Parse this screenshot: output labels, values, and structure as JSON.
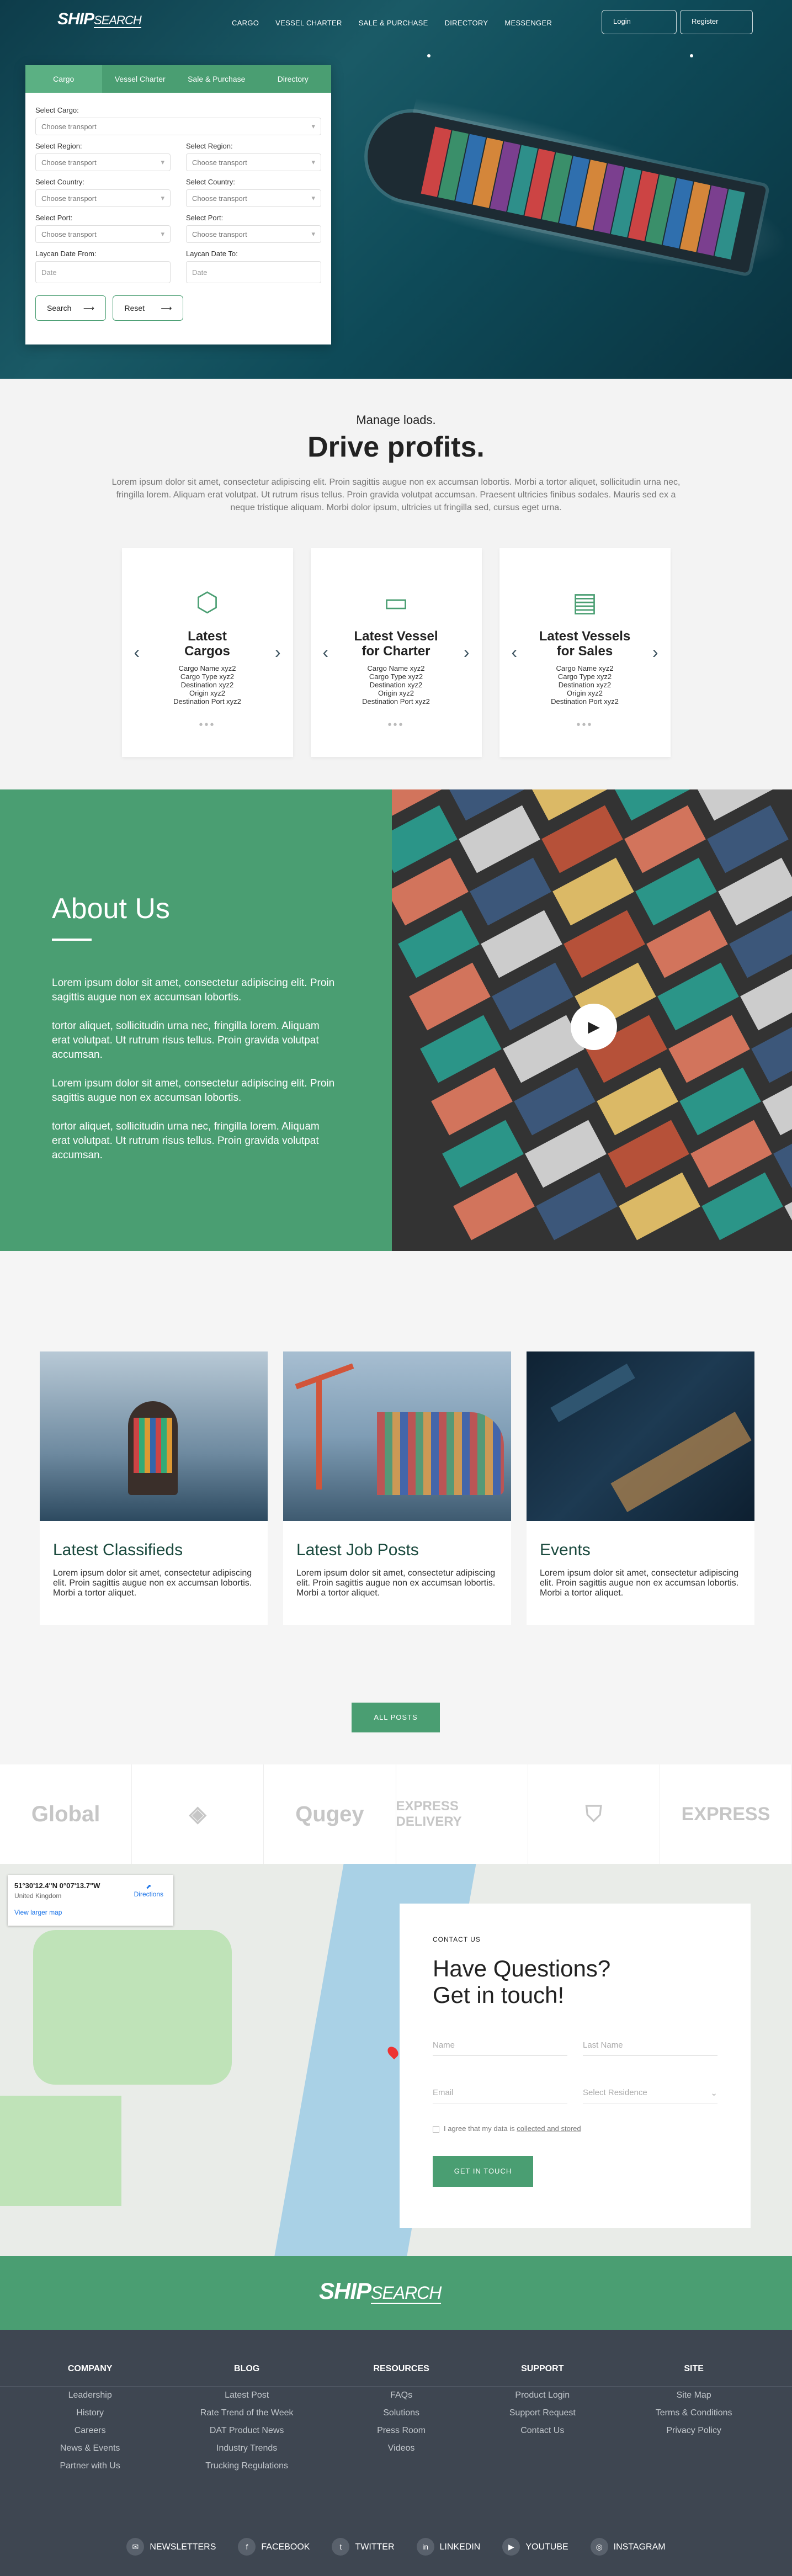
{
  "brand": {
    "logo_main": "SHIP",
    "logo_sub": "SEARCH"
  },
  "nav": {
    "links": [
      "CARGO",
      "VESSEL CHARTER",
      "SALE & PURCHASE",
      "DIRECTORY",
      "MESSENGER"
    ],
    "login": "Login",
    "register": "Register"
  },
  "search": {
    "tabs": [
      "Cargo",
      "Vessel Charter",
      "Sale & Purchase",
      "Directory"
    ],
    "cargo_label": "Select Cargo:",
    "cargo_ph": "Choose transport",
    "region_label": "Select Region:",
    "region_ph": "Choose transport",
    "country_label": "Select Country:",
    "country_ph": "Choose transport",
    "port_label": "Select Port:",
    "port_ph": "Choose transport",
    "from_label": "Laycan Date From:",
    "to_label": "Laycan Date To:",
    "date_ph": "Date",
    "search_btn": "Search",
    "reset_btn": "Reset"
  },
  "drive": {
    "kicker": "Manage loads.",
    "title": "Drive profits.",
    "body": "Lorem ipsum dolor sit amet, consectetur adipiscing elit. Proin sagittis augue non ex accumsan lobortis. Morbi a tortor aliquet, sollicitudin urna nec, fringilla lorem. Aliquam erat volutpat. Ut rutrum risus tellus. Proin gravida volutpat accumsan. Praesent ultricies finibus sodales. Mauris sed ex a neque tristique aliquam. Morbi dolor ipsum, ultricies ut fringilla sed, cursus eget urna.",
    "cards": [
      {
        "title1": "Latest",
        "title2": "Cargos",
        "lines": [
          "Cargo Name xyz2",
          "Cargo Type xyz2",
          "Destination xyz2",
          "Origin xyz2",
          "Destination Port xyz2"
        ]
      },
      {
        "title1": "Latest Vessel",
        "title2": "for Charter",
        "lines": [
          "Cargo Name xyz2",
          "Cargo Type xyz2",
          "Destination xyz2",
          "Origin xyz2",
          "Destination Port xyz2"
        ]
      },
      {
        "title1": "Latest Vessels",
        "title2": "for Sales",
        "lines": [
          "Cargo Name xyz2",
          "Cargo Type xyz2",
          "Destination xyz2",
          "Origin xyz2",
          "Destination Port xyz2"
        ]
      }
    ]
  },
  "about": {
    "title": "About Us",
    "paras": [
      "Lorem ipsum dolor sit amet, consectetur adipiscing elit. Proin sagittis augue non ex accumsan lobortis.",
      "tortor aliquet, sollicitudin urna nec, fringilla lorem. Aliquam erat volutpat. Ut rutrum risus tellus. Proin gravida volutpat accumsan.",
      "Lorem ipsum dolor sit amet, consectetur adipiscing elit. Proin sagittis augue non ex accumsan lobortis.",
      "tortor aliquet, sollicitudin urna nec, fringilla lorem. Aliquam erat volutpat. Ut rutrum risus tellus. Proin gravida volutpat accumsan."
    ]
  },
  "posts": {
    "items": [
      {
        "title": "Latest Classifieds",
        "body": "Lorem ipsum dolor sit amet, consectetur adipiscing elit. Proin sagittis augue non ex accumsan lobortis. Morbi a tortor aliquet."
      },
      {
        "title": "Latest Job Posts",
        "body": "Lorem ipsum dolor sit amet, consectetur adipiscing elit. Proin sagittis augue non ex accumsan lobortis. Morbi a tortor aliquet."
      },
      {
        "title": "Events",
        "body": "Lorem ipsum dolor sit amet, consectetur adipiscing elit. Proin sagittis augue non ex accumsan lobortis. Morbi a tortor aliquet."
      }
    ],
    "all_btn": "ALL POSTS"
  },
  "brands": [
    "Global",
    "",
    "Qugey",
    "EXPRESS DELIVERY",
    "",
    "EXPRESS"
  ],
  "map": {
    "coords": "51°30'12.4\"N 0°07'13.7\"W",
    "place": "United Kingdom",
    "directions": "Directions",
    "larger": "View larger map"
  },
  "contact": {
    "kicker": "CONTACT US",
    "title1": "Have Questions?",
    "title2": "Get in touch!",
    "name_ph": "Name",
    "last_ph": "Last Name",
    "email_ph": "Email",
    "residence_ph": "Select Residence",
    "agree_pre": "I agree that my data is ",
    "agree_link": "collected and stored",
    "submit": "GET IN TOUCH"
  },
  "footer": {
    "cols": [
      {
        "title": "COMPANY",
        "items": [
          "Leadership",
          "History",
          "Careers",
          "News & Events",
          "Partner with Us"
        ]
      },
      {
        "title": "BLOG",
        "items": [
          "Latest Post",
          "Rate Trend of the Week",
          "DAT Product News",
          "Industry Trends",
          "Trucking Regulations"
        ]
      },
      {
        "title": "RESOURCES",
        "items": [
          "FAQs",
          "Solutions",
          "Press Room",
          "Videos"
        ]
      },
      {
        "title": "SUPPORT",
        "items": [
          "Product Login",
          "Support Request",
          "Contact Us"
        ]
      },
      {
        "title": "SITE",
        "items": [
          "Site Map",
          "Terms & Conditions",
          "Privacy Policy"
        ]
      }
    ],
    "social": [
      "NEWSLETTERS",
      "FACEBOOK",
      "TWITTER",
      "LINKEDIN",
      "YOUTUBE",
      "INSTAGRAM"
    ]
  },
  "colors": {
    "green": "#4a9e72",
    "footer": "#3e4651"
  }
}
